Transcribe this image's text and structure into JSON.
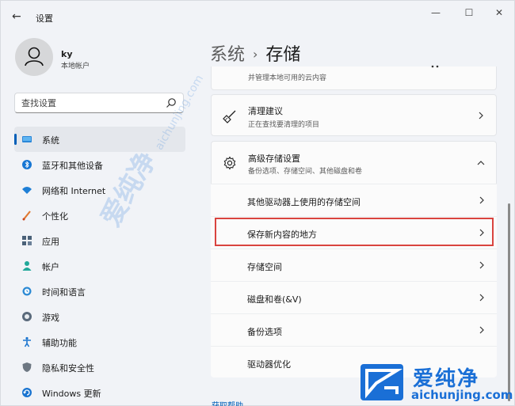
{
  "window": {
    "title": "设置",
    "back_glyph": "←",
    "min_glyph": "—",
    "max_glyph": "☐",
    "close_glyph": "✕"
  },
  "user": {
    "name": "ky",
    "account_type": "本地帐户"
  },
  "search": {
    "placeholder": "查找设置"
  },
  "sidebar": {
    "items": [
      {
        "label": "系统",
        "icon": "monitor-icon",
        "active": true
      },
      {
        "label": "蓝牙和其他设备",
        "icon": "bluetooth-icon"
      },
      {
        "label": "网络和 Internet",
        "icon": "wifi-icon"
      },
      {
        "label": "个性化",
        "icon": "brush-icon"
      },
      {
        "label": "应用",
        "icon": "apps-icon"
      },
      {
        "label": "帐户",
        "icon": "person-icon"
      },
      {
        "label": "时间和语言",
        "icon": "globe-clock-icon"
      },
      {
        "label": "游戏",
        "icon": "gamepad-icon"
      },
      {
        "label": "辅助功能",
        "icon": "accessibility-icon"
      },
      {
        "label": "隐私和安全性",
        "icon": "shield-icon"
      },
      {
        "label": "Windows 更新",
        "icon": "update-icon"
      }
    ]
  },
  "breadcrumb": {
    "parent": "系统",
    "separator": "›",
    "current": "存储"
  },
  "cards": {
    "cloud": {
      "subtitle": "并管理本地可用的云内容"
    },
    "cleanup": {
      "title": "清理建议",
      "subtitle": "正在查找要清理的项目",
      "icon": "broom-icon"
    },
    "advanced": {
      "title": "高级存储设置",
      "subtitle": "备份选项、存储空间、其他磁盘和卷",
      "icon": "gear-icon",
      "expanded": true
    }
  },
  "advanced_items": [
    {
      "label": "其他驱动器上使用的存储空间"
    },
    {
      "label": "保存新内容的地方",
      "highlighted": true
    },
    {
      "label": "存储空间"
    },
    {
      "label": "磁盘和卷(&V)"
    },
    {
      "label": "备份选项"
    },
    {
      "label": "驱动器优化"
    }
  ],
  "footer": {
    "help_link": "获取帮助"
  },
  "watermark": {
    "text_cn": "爱纯净",
    "text_url": "aichunjing.com"
  },
  "colors": {
    "accent": "#005fb8",
    "highlight": "#d9443f",
    "watermark": "#1a6fd6"
  }
}
